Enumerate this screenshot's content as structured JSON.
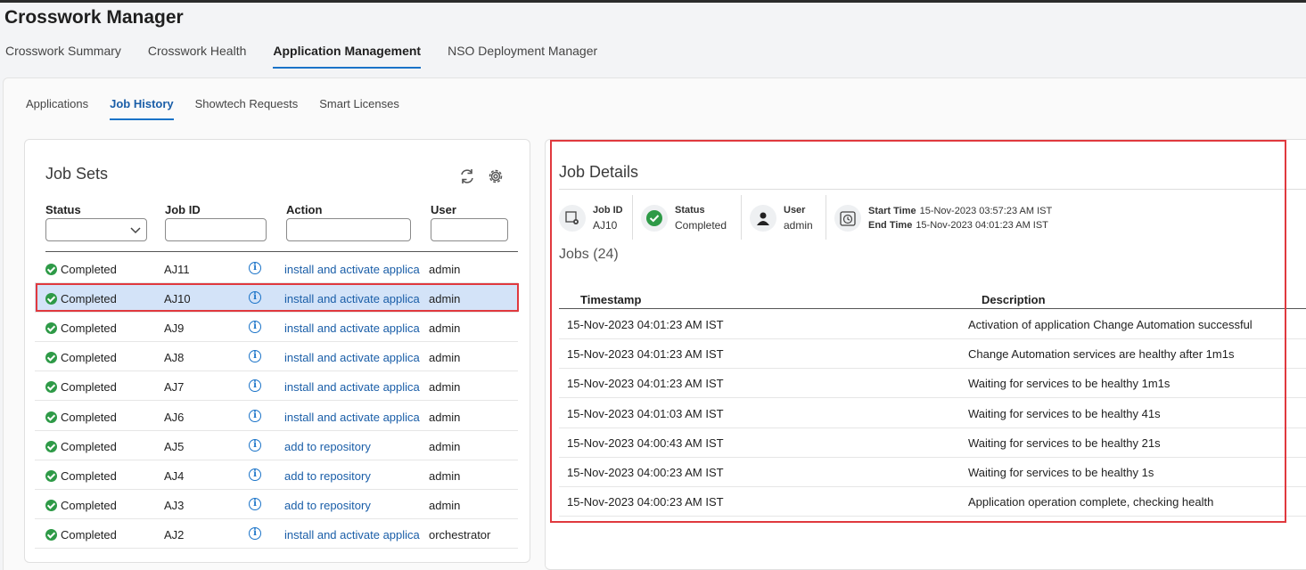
{
  "app": {
    "title": "Crosswork Manager"
  },
  "main_tabs": [
    {
      "label": "Crosswork Summary",
      "active": false
    },
    {
      "label": "Crosswork Health",
      "active": false
    },
    {
      "label": "Application Management",
      "active": true
    },
    {
      "label": "NSO Deployment Manager",
      "active": false
    }
  ],
  "sub_tabs": [
    {
      "label": "Applications",
      "active": false
    },
    {
      "label": "Job History",
      "active": true
    },
    {
      "label": "Showtech Requests",
      "active": false
    },
    {
      "label": "Smart Licenses",
      "active": false
    }
  ],
  "job_sets": {
    "title": "Job Sets",
    "columns": {
      "status": "Status",
      "job_id": "Job ID",
      "action": "Action",
      "user": "User"
    },
    "filters": {
      "status": "",
      "job_id": "",
      "action": "",
      "user": ""
    },
    "selected_id": "AJ10",
    "rows": [
      {
        "status": "Completed",
        "job_id": "AJ11",
        "action": "install and activate applica",
        "user": "admin"
      },
      {
        "status": "Completed",
        "job_id": "AJ10",
        "action": "install and activate applica",
        "user": "admin"
      },
      {
        "status": "Completed",
        "job_id": "AJ9",
        "action": "install and activate applica",
        "user": "admin"
      },
      {
        "status": "Completed",
        "job_id": "AJ8",
        "action": "install and activate applica",
        "user": "admin"
      },
      {
        "status": "Completed",
        "job_id": "AJ7",
        "action": "install and activate applica",
        "user": "admin"
      },
      {
        "status": "Completed",
        "job_id": "AJ6",
        "action": "install and activate applica",
        "user": "admin"
      },
      {
        "status": "Completed",
        "job_id": "AJ5",
        "action": "add to repository",
        "user": "admin"
      },
      {
        "status": "Completed",
        "job_id": "AJ4",
        "action": "add to repository",
        "user": "admin"
      },
      {
        "status": "Completed",
        "job_id": "AJ3",
        "action": "add to repository",
        "user": "admin"
      },
      {
        "status": "Completed",
        "job_id": "AJ2",
        "action": "install and activate applica",
        "user": "orchestrator"
      }
    ]
  },
  "job_details": {
    "title": "Job Details",
    "job_id_label": "Job ID",
    "job_id": "AJ10",
    "status_label": "Status",
    "status": "Completed",
    "user_label": "User",
    "user": "admin",
    "start_label": "Start Time",
    "start_time": "15-Nov-2023 03:57:23 AM IST",
    "end_label": "End Time",
    "end_time": "15-Nov-2023 04:01:23 AM IST"
  },
  "jobs": {
    "title": "Jobs (24)",
    "columns": {
      "timestamp": "Timestamp",
      "description": "Description"
    },
    "rows": [
      {
        "timestamp": "15-Nov-2023 04:01:23 AM IST",
        "description": "Activation of application Change Automation successful"
      },
      {
        "timestamp": "15-Nov-2023 04:01:23 AM IST",
        "description": "Change Automation services are healthy after 1m1s"
      },
      {
        "timestamp": "15-Nov-2023 04:01:23 AM IST",
        "description": "Waiting for services to be healthy 1m1s"
      },
      {
        "timestamp": "15-Nov-2023 04:01:03 AM IST",
        "description": "Waiting for services to be healthy 41s"
      },
      {
        "timestamp": "15-Nov-2023 04:00:43 AM IST",
        "description": "Waiting for services to be healthy 21s"
      },
      {
        "timestamp": "15-Nov-2023 04:00:23 AM IST",
        "description": "Waiting for services to be healthy 1s"
      },
      {
        "timestamp": "15-Nov-2023 04:00:23 AM IST",
        "description": "Application operation complete, checking health"
      }
    ]
  },
  "colors": {
    "accent": "#1a73c8",
    "link": "#1a5ea8",
    "success": "#2e9a47",
    "highlight": "#e0393e",
    "selected_row": "#d3e3f8"
  }
}
